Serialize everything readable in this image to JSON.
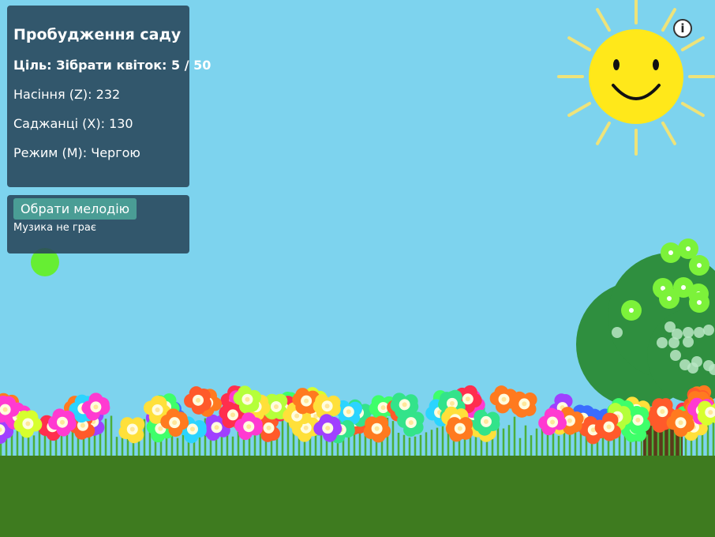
{
  "hud": {
    "title": "Пробудження саду",
    "goal": "Ціль: Зібрати квіток: 5 / 50",
    "seeds": "Насіння (Z): 232",
    "seedlings": "Саджанці (X): 130",
    "mode": "Режим (M): Чергою"
  },
  "music": {
    "button_label": "Обрати мелодію",
    "status": "Музика не грає"
  },
  "info_button": {
    "label": "i"
  },
  "colors": {
    "sky": "#7dd3ee",
    "ground": "#3e7b1f",
    "sun": "#ffe81a",
    "sun_rays": "#eee37a",
    "tree": "#2f8f3f",
    "panel": "rgba(40,70,90,0.88)",
    "button": "#4a9d95"
  },
  "flower_palette": [
    "#ff2e4d",
    "#ff7a1f",
    "#ffe03a",
    "#b5ff3a",
    "#3eff6a",
    "#2bd4ff",
    "#3a6cff",
    "#a040ff",
    "#ff3ad1",
    "#ff5a2a",
    "#33e38a",
    "#d7ff2e"
  ],
  "icons": {
    "sun": "smiling-sun-icon",
    "info": "info-icon",
    "cursor": "green-seed-cursor-icon"
  }
}
